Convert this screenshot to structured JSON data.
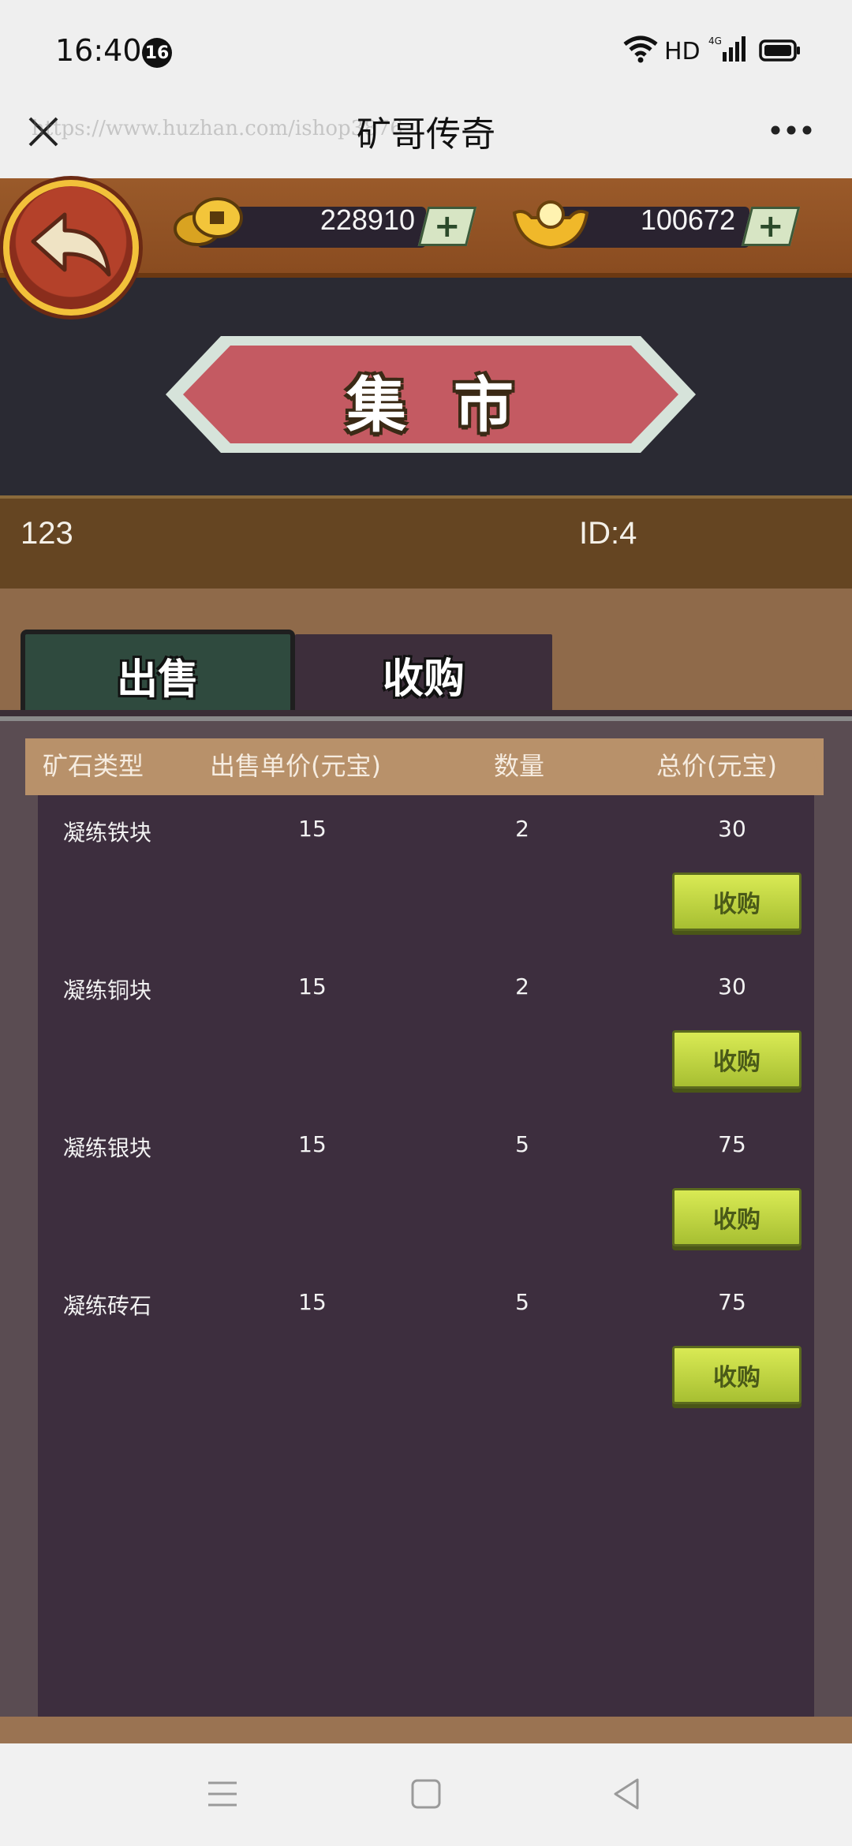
{
  "status_bar": {
    "time": "16:40",
    "notification_count": "16",
    "network": "HD"
  },
  "title_bar": {
    "title": "矿哥传奇",
    "watermark": "https://www.huzhan.com/ishop3876"
  },
  "resources": {
    "coins": "228910",
    "ingots": "100672",
    "plus": "+"
  },
  "banner": {
    "title": "集市"
  },
  "player": {
    "name": "123",
    "id": "ID:4"
  },
  "tabs": [
    {
      "label": "出售",
      "active": false
    },
    {
      "label": "收购",
      "active": true
    }
  ],
  "table": {
    "headers": [
      "矿石类型",
      "出售单价(元宝)",
      "数量",
      "总价(元宝)"
    ],
    "rows": [
      {
        "type": "凝练铁块",
        "price": "15",
        "qty": "2",
        "total": "30",
        "action": "收购"
      },
      {
        "type": "凝练铜块",
        "price": "15",
        "qty": "2",
        "total": "30",
        "action": "收购"
      },
      {
        "type": "凝练银块",
        "price": "15",
        "qty": "5",
        "total": "75",
        "action": "收购"
      },
      {
        "type": "凝练砖石",
        "price": "15",
        "qty": "5",
        "total": "75",
        "action": "收购"
      }
    ]
  },
  "colors": {
    "sell_tab": "#2f4a3e",
    "buy_tab": "#3d2e3b",
    "buy_button": "#c6dc48",
    "banner": "#c45a62"
  },
  "icons": [
    "back-arrow-icon",
    "coin-icon",
    "gold-ingot-icon",
    "plus-icon",
    "close-icon",
    "more-icon",
    "menu-icon",
    "home-icon",
    "back-nav-icon"
  ]
}
